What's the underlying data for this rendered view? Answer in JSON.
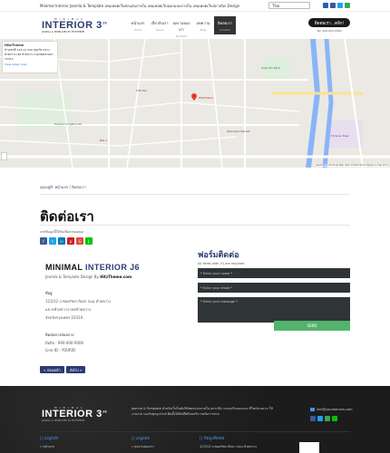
{
  "topbar": {
    "tagline": "Minimal Interior Joomla & Template   เทมเพลตเว็บตกแต่งภายใน เทมเพลตเว็บออกแบบภายใน เทมเพลตเว็บสถาปนิก Design",
    "language": "Thai",
    "social": [
      "#2a5db0",
      "#3b5998",
      "#1da1f2",
      "#34a853"
    ]
  },
  "header": {
    "logo": {
      "top": "MINIMAL",
      "main": "INTERIOR 3",
      "sup": "J6",
      "tag": "JOOMLA & TEMPLATES BY HITZTHEME"
    },
    "nav": [
      {
        "label": "หน้าแรก",
        "sub": "Home",
        "active": false
      },
      {
        "label": "เกี่ยวกับเรา",
        "sub": "About",
        "active": false
      },
      {
        "label": "ผลงานของเรา",
        "sub": "Portfolio",
        "active": false
      },
      {
        "label": "บทความ",
        "sub": "Blog",
        "active": false
      },
      {
        "label": "ติดต่อเรา",
        "sub": "Contact",
        "active": true
      }
    ],
    "cta": "ติดต่อเรา...คลิก!",
    "phone": "Tel. 090-000-0000"
  },
  "map": {
    "card_name": "HitzTheme",
    "card_addr": "บ้านเลขที่ 123/12 ถนน สุขุมวิท แขวง ห้วยขวาง เขต ห้วยขวาง กรุงเทพมหานคร 10310",
    "card_link": "View larger map",
    "pin_label": "HitzTheme",
    "labels": [
      "Pracha Songkhro Rd",
      "BIG C",
      "TOP Tea",
      "Suan Plu Park",
      "Ratchada Market",
      "Fortune Town"
    ],
    "footer": "Keyboard shortcuts  Map data ©2023  Terms  Report a map error"
  },
  "breadcrumb": {
    "prefix": "คุณอยู่ที่:",
    "home": "หน้าแรก",
    "sep": "/",
    "current": "ติดต่อเรา"
  },
  "page": {
    "title": "ติดต่อเรา"
  },
  "share": {
    "label": "แชร์ข้อมูลนี้ให้กับเพื่อนๆของคุณ",
    "icons": [
      {
        "glyph": "f",
        "color": "#3b5998"
      },
      {
        "glyph": "t",
        "color": "#1da1f2"
      },
      {
        "glyph": "in",
        "color": "#0077b5"
      },
      {
        "glyph": "p",
        "color": "#cb2027"
      },
      {
        "glyph": "G",
        "color": "#dd4b39"
      },
      {
        "glyph": "L",
        "color": "#00c300"
      }
    ]
  },
  "company": {
    "name_a": "MINIMAL ",
    "name_b": "INTERIOR J6",
    "desc_prefix": "Joomla & Template Design By ",
    "desc_brand": "HitzTheme.com",
    "addr_head": "ที่อยู่:",
    "addr_1": "123/12 ถ.ซอยรัชดาภิเษก ถนน ห้วยขวาง",
    "addr_2": "แขวงห้วยขวาง เขตห้วยขวาง",
    "addr_3": "จังหวัดกรุงเทพฯ 10310",
    "contact_head": "ติดต่อทางช่องทาง:",
    "tel": "มือถือ : 090-000-0000",
    "line": "Line ID : YOURID"
  },
  "pager": {
    "prev": "« ก่อนหน้า",
    "next": "ถัดไป »"
  },
  "form": {
    "title": "ฟอร์มติดต่อ",
    "required": "All fields with (*) are required",
    "name_ph": "* Enter your name *",
    "email_ph": "* Enter your email *",
    "message_ph": "* Enter your message *",
    "send": "SEND"
  },
  "footer": {
    "logo": {
      "top": "MINIMAL",
      "main": "INTERIOR 3",
      "sup": "J6",
      "tag": "JOOMLA & TEMPLATES BY HITZTHEME"
    },
    "about": "Joomla & Template สำหรับเว็บไซต์บริษัทตกแต่งภายใน สถาปนิก และธุรกิจออกแบบ ดีไซน์สวยงาม ใช้งานง่าย รองรับทุกอุปกรณ์ ติดตั้งได้ทันทีพร้อมบริการหลังการขาย",
    "email": "info@yourdomain.com",
    "social": [
      "#3b5998",
      "#1da1f2",
      "#34a853",
      "#00c300"
    ],
    "col1_title": "|| เมนูหลัก",
    "col1_item": "» หน้าแรก",
    "col2_title": "|| เมนูย่อย",
    "col2_item": "» ผลงานของเรา",
    "col3_title": "|| ข้อมูลติดต่อ",
    "col3_item": "123/12 ถ.ซอยรัชดาภิเษก ถนน ห้วยขวาง"
  }
}
